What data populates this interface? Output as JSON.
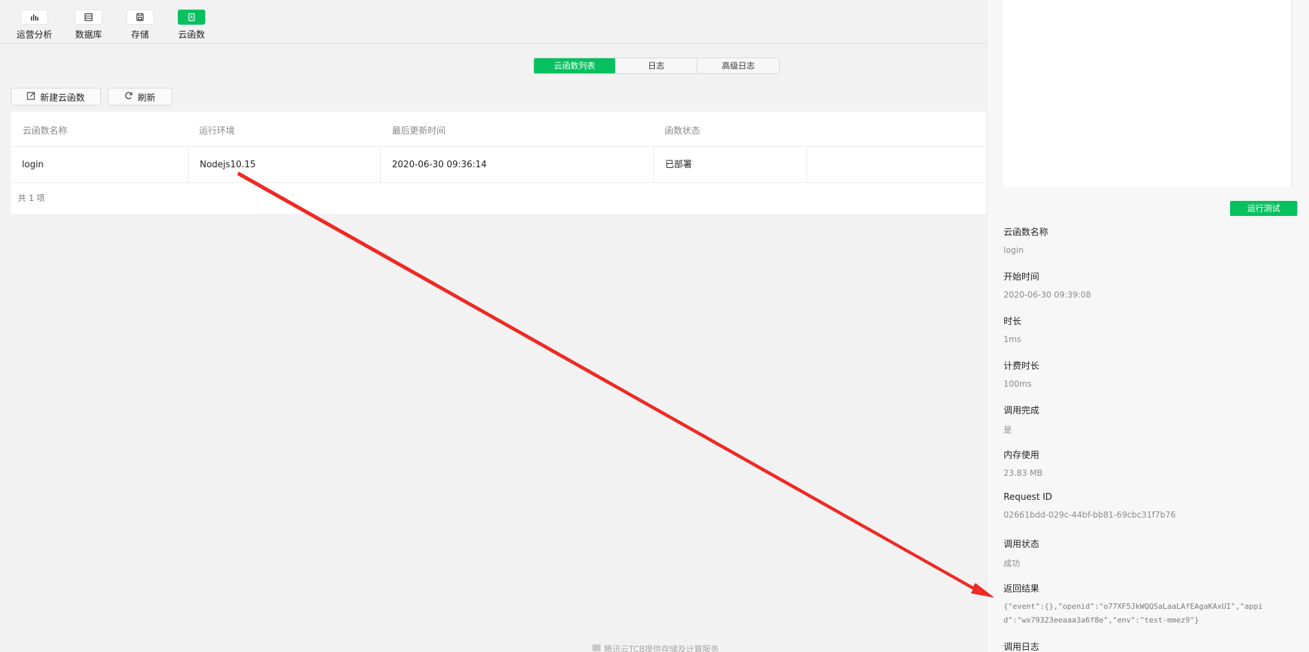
{
  "toolbar": {
    "items": [
      {
        "label": "运营分析",
        "icon": "bar-chart-icon"
      },
      {
        "label": "数据库",
        "icon": "database-icon"
      },
      {
        "label": "存储",
        "icon": "save-icon"
      },
      {
        "label": "云函数",
        "icon": "cloud-function-icon",
        "active": true
      }
    ]
  },
  "tabs": [
    {
      "label": "云函数列表",
      "active": true
    },
    {
      "label": "日志"
    },
    {
      "label": "高级日志"
    }
  ],
  "actions": {
    "new_label": "新建云函数",
    "refresh_label": "刷新"
  },
  "table": {
    "columns": [
      "云函数名称",
      "运行环境",
      "最后更新时间",
      "函数状态"
    ],
    "rows": [
      {
        "name": "login",
        "runtime": "Nodejs10.15",
        "updated": "2020-06-30 09:36:14",
        "status": "已部署"
      }
    ],
    "total": "共 1 项"
  },
  "panel": {
    "run_test_label": "运行测试",
    "fields": {
      "name": {
        "label": "云函数名称",
        "value": "login"
      },
      "start": {
        "label": "开始时间",
        "value": "2020-06-30 09:39:08"
      },
      "duration": {
        "label": "时长",
        "value": "1ms"
      },
      "billed": {
        "label": "计费时长",
        "value": "100ms"
      },
      "completed": {
        "label": "调用完成",
        "value": "是"
      },
      "memory": {
        "label": "内存使用",
        "value": "23.83 MB"
      },
      "request_id": {
        "label": "Request ID",
        "value": "02661bdd-029c-44bf-bb81-69cbc31f7b76"
      },
      "call_status": {
        "label": "调用状态",
        "value": "成功"
      },
      "result": {
        "label": "返回结果",
        "value": "{\"event\":{},\"openid\":\"o77XF5JkWQQSaLaaLAfEAgaKAxUI\",\"appid\":\"wx79323eeaaa3a6f8e\",\"env\":\"test-mmez9\"}"
      },
      "call_log": {
        "label": "调用日志"
      }
    }
  },
  "footer": {
    "text": "腾讯云TCB提供存储及计算服务"
  },
  "colors": {
    "accent": "#07c160",
    "annotation": "#ee2a24"
  }
}
